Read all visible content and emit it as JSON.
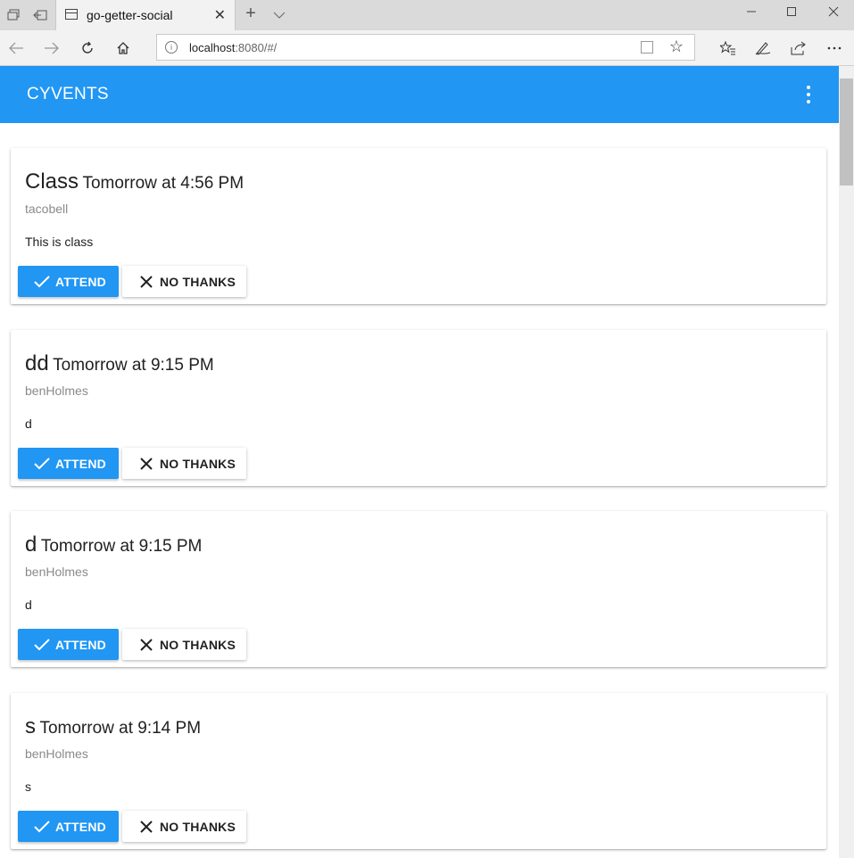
{
  "browser": {
    "tab_title": "go-getter-social",
    "url_host": "localhost",
    "url_rest": ":8080/#/"
  },
  "app": {
    "brand": "CYVENTS",
    "accent_color": "#2196f3"
  },
  "events": [
    {
      "name": "Class",
      "when": "Tomorrow at 4:56 PM",
      "user": "tacobell",
      "description": "This is class",
      "attend_label": "ATTEND",
      "decline_label": "NO THANKS"
    },
    {
      "name": "dd",
      "when": "Tomorrow at 9:15 PM",
      "user": "benHolmes",
      "description": "d",
      "attend_label": "ATTEND",
      "decline_label": "NO THANKS"
    },
    {
      "name": "d",
      "when": "Tomorrow at 9:15 PM",
      "user": "benHolmes",
      "description": "d",
      "attend_label": "ATTEND",
      "decline_label": "NO THANKS"
    },
    {
      "name": "s",
      "when": "Tomorrow at 9:14 PM",
      "user": "benHolmes",
      "description": "s",
      "attend_label": "ATTEND",
      "decline_label": "NO THANKS"
    }
  ]
}
